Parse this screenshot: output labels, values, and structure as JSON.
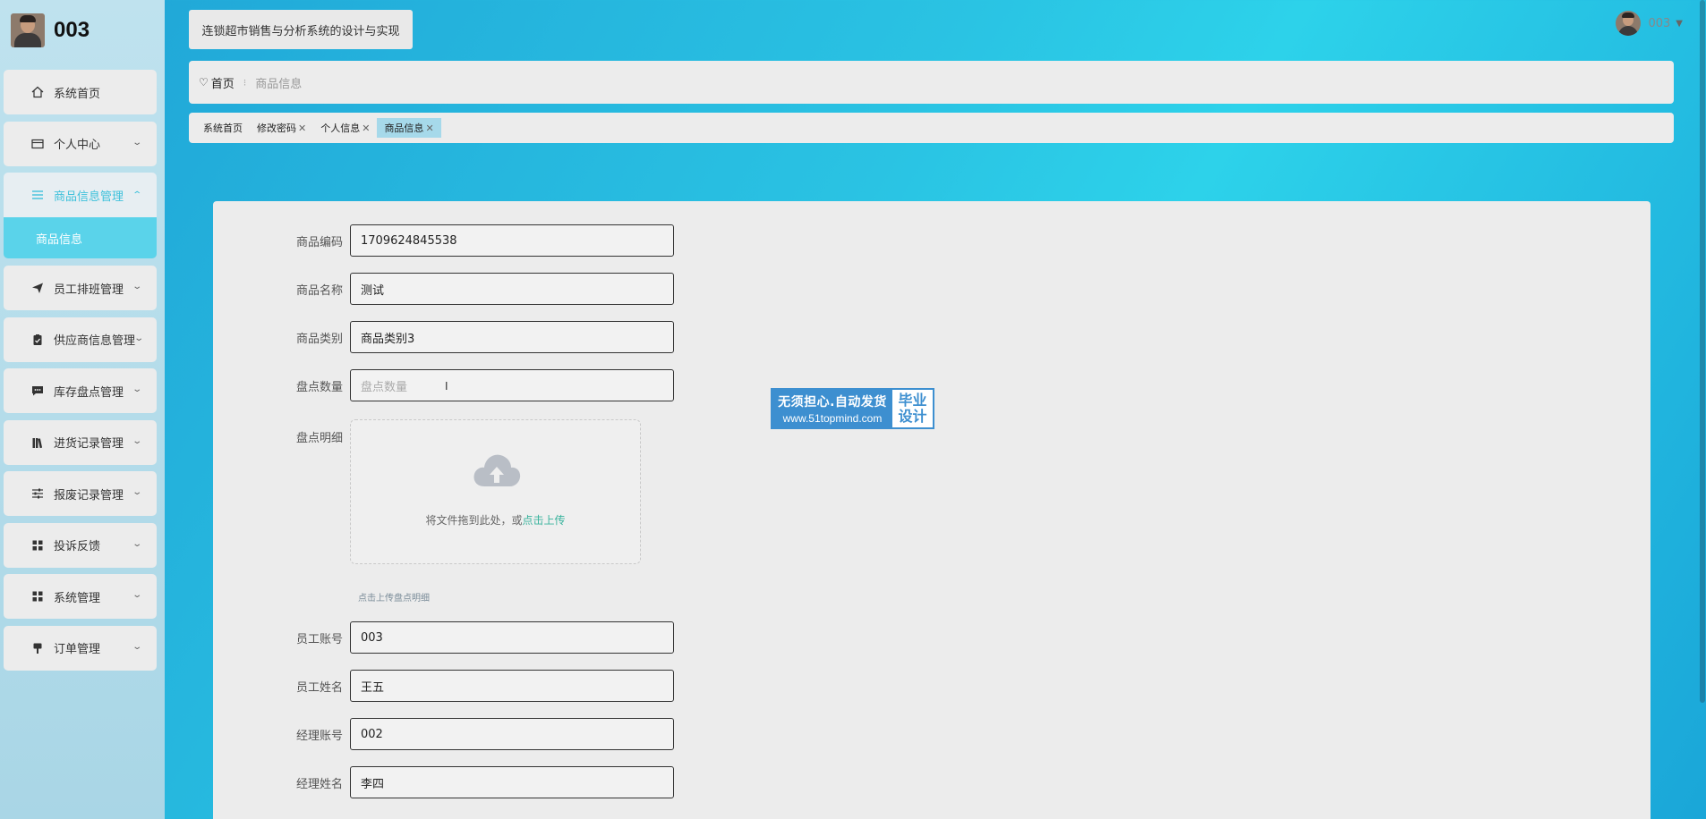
{
  "sidebar": {
    "brand_name": "003",
    "menu": [
      {
        "label": "系统首页",
        "icon": "home-icon",
        "has_chevron": false
      },
      {
        "label": "个人中心",
        "icon": "card-icon",
        "has_chevron": true
      },
      {
        "label": "商品信息管理",
        "icon": "list-icon",
        "has_chevron": true,
        "open": true,
        "children": [
          "商品信息"
        ]
      },
      {
        "label": "员工排班管理",
        "icon": "send-icon",
        "has_chevron": true
      },
      {
        "label": "供应商信息管理",
        "icon": "clipboard-icon",
        "has_chevron": true
      },
      {
        "label": "库存盘点管理",
        "icon": "chat-icon",
        "has_chevron": true
      },
      {
        "label": "进货记录管理",
        "icon": "books-icon",
        "has_chevron": true
      },
      {
        "label": "报废记录管理",
        "icon": "sliders-icon",
        "has_chevron": true
      },
      {
        "label": "投诉反馈",
        "icon": "grid-icon",
        "has_chevron": true
      },
      {
        "label": "系统管理",
        "icon": "grid-icon",
        "has_chevron": true
      },
      {
        "label": "订单管理",
        "icon": "brush-icon",
        "has_chevron": true
      }
    ]
  },
  "header": {
    "system_title": "连锁超市销售与分析系统的设计与实现",
    "user_name": "003"
  },
  "breadcrumb": {
    "home": "首页",
    "current": "商品信息"
  },
  "tabs": [
    {
      "label": "系统首页",
      "closable": false,
      "active": false
    },
    {
      "label": "修改密码",
      "closable": true,
      "active": false
    },
    {
      "label": "个人信息",
      "closable": true,
      "active": false
    },
    {
      "label": "商品信息",
      "closable": true,
      "active": true
    }
  ],
  "form": {
    "product_code": {
      "label": "商品编码",
      "value": "1709624845538"
    },
    "product_name": {
      "label": "商品名称",
      "value": "测试"
    },
    "product_category": {
      "label": "商品类别",
      "value": "商品类别3"
    },
    "stock_count": {
      "label": "盘点数量",
      "placeholder": "盘点数量",
      "value": ""
    },
    "stock_detail": {
      "label": "盘点明细",
      "drop_text": "将文件拖到此处，或",
      "drop_link": "点击上传",
      "hint": "点击上传盘点明细"
    },
    "employee_account": {
      "label": "员工账号",
      "value": "003"
    },
    "employee_name": {
      "label": "员工姓名",
      "value": "王五"
    },
    "manager_account": {
      "label": "经理账号",
      "value": "002"
    },
    "manager_name": {
      "label": "经理姓名",
      "value": "李四"
    }
  },
  "watermark": {
    "line1": "无须担心.自动发货",
    "line2": "www.51topmind.com",
    "right1": "毕业",
    "right2": "设计"
  },
  "colors": {
    "accent": "#3fc1db",
    "submenu_active": "#5ad3ea",
    "upload_link": "#3ab39d",
    "watermark_blue": "#3d8fd0"
  }
}
